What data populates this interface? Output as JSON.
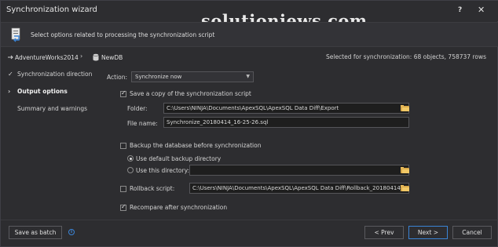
{
  "window": {
    "title": "Synchronization wizard",
    "help_label": "?",
    "close_label": "✕"
  },
  "watermark": "solutioniews.com",
  "header": {
    "text": "Select options related to processing the synchronization script"
  },
  "databases": {
    "source": "AdventureWorks2014",
    "chevron": "›",
    "target": "NewDB",
    "selected_summary": "Selected for synchronization: 68 objects, 758737 rows"
  },
  "steps": [
    {
      "label": "Synchronization direction",
      "check": "✓"
    },
    {
      "label": "Output options",
      "check": "›"
    },
    {
      "label": "Summary and warnings",
      "check": ""
    }
  ],
  "options": {
    "action_label": "Action:",
    "action_value": "Synchronize now",
    "save_copy_label": "Save a copy of the synchronization script",
    "folder_label": "Folder:",
    "folder_value": "C:\\Users\\NINJA\\Documents\\ApexSQL\\ApexSQL Data Diff\\Export",
    "filename_label": "File name:",
    "filename_value": "Synchronize_20180414_16-25-26.sql",
    "backup_label": "Backup the database before synchronization",
    "default_dir_label": "Use default backup directory",
    "this_dir_label": "Use this directory:",
    "this_dir_value": "",
    "rollback_label": "Rollback script:",
    "rollback_value": "C:\\Users\\NINJA\\Documents\\ApexSQL\\ApexSQL Data Diff\\Rollback_20180414_04:",
    "recompare_label": "Recompare after synchronization"
  },
  "footer": {
    "save_batch": "Save as batch",
    "info": "i",
    "prev": "< Prev",
    "next": "Next >",
    "cancel": "Cancel"
  },
  "colors": {
    "background": "#2d2d30",
    "accent": "#3b84d6",
    "folder": "#f1c866"
  }
}
